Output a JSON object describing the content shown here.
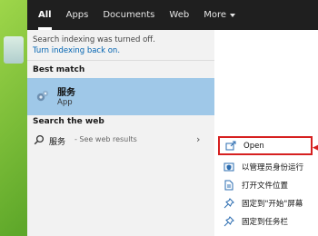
{
  "tabs": [
    {
      "label": "All",
      "active": true
    },
    {
      "label": "Apps"
    },
    {
      "label": "Documents"
    },
    {
      "label": "Web"
    },
    {
      "label": "More"
    }
  ],
  "results": {
    "notice": "Search indexing was turned off.",
    "notice_link": "Turn indexing back on.",
    "best_match_header": "Best match",
    "best_match": {
      "title": "服务",
      "subtitle": "App",
      "icon": "gear-service-icon"
    },
    "web_header": "Search the web",
    "web_result": {
      "term": "服务",
      "hint": " - See web results",
      "icon": "search-icon"
    }
  },
  "context_menu": [
    {
      "label": "Open",
      "icon": "open-window-icon",
      "highlighted": true
    },
    {
      "label": "以管理员身份运行",
      "icon": "shield-admin-icon"
    },
    {
      "label": "打开文件位置",
      "icon": "file-location-icon"
    },
    {
      "label": "固定到\"开始\"屏幕",
      "icon": "pin-icon"
    },
    {
      "label": "固定到任务栏",
      "icon": "pin-taskbar-icon"
    }
  ],
  "colors": {
    "highlight": "#9fc8e8",
    "link": "#0063b1",
    "annotation_red": "#d62020",
    "topbar": "#1f1f1f"
  }
}
